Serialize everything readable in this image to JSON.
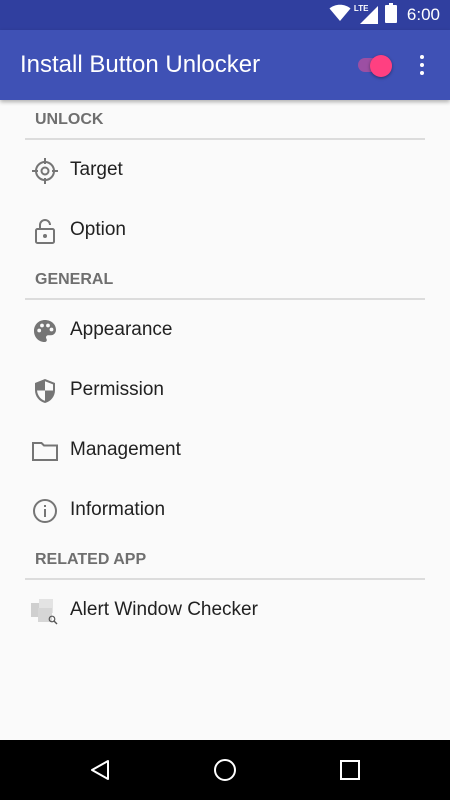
{
  "status_bar": {
    "network_label": "LTE",
    "time": "6:00",
    "icons": [
      "wifi-icon",
      "lte-signal-icon",
      "battery-icon"
    ]
  },
  "app_bar": {
    "title": "Install Button Unlocker",
    "toggle_on": true,
    "menu_icon": "overflow-menu-icon"
  },
  "sections": [
    {
      "header": "UNLOCK",
      "items": [
        {
          "label": "Target",
          "icon": "crosshair-icon"
        },
        {
          "label": "Option",
          "icon": "lock-open-icon"
        }
      ]
    },
    {
      "header": "GENERAL",
      "items": [
        {
          "label": "Appearance",
          "icon": "palette-icon"
        },
        {
          "label": "Permission",
          "icon": "shield-icon"
        },
        {
          "label": "Management",
          "icon": "folder-icon"
        },
        {
          "label": "Information",
          "icon": "info-icon"
        }
      ]
    },
    {
      "header": "RELATED APP",
      "items": [
        {
          "label": "Alert Window Checker",
          "icon": "alert-window-checker-app-icon"
        }
      ]
    }
  ],
  "nav_bar": {
    "buttons": [
      "back-icon",
      "home-icon",
      "recents-icon"
    ]
  },
  "colors": {
    "primary": "#3f51b5",
    "primary_dark": "#303f9f",
    "accent": "#ff4081",
    "icon_gray": "#757575"
  }
}
